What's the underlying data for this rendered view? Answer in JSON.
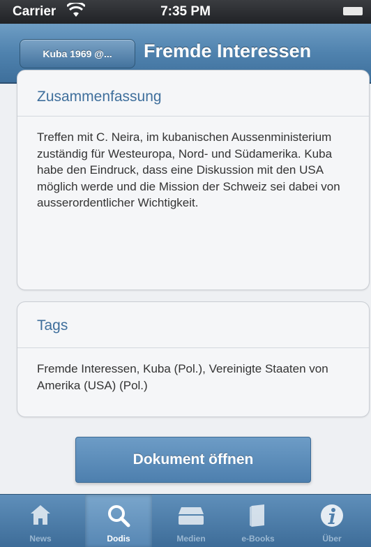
{
  "status_bar": {
    "carrier": "Carrier",
    "time": "7:35 PM"
  },
  "nav_bar": {
    "back_label": "Kuba 1969 @...",
    "title": "Fremde Interessen"
  },
  "summary": {
    "heading": "Zusammenfassung",
    "text": "Treffen mit C. Neira, im kubanischen Aussenministerium zuständig für Westeuropa, Nord- und Südamerika. Kuba habe den Eindruck, dass eine Diskussion mit den USA möglich werde und die Mission der Schweiz sei dabei von ausserordentlicher Wichtigkeit."
  },
  "tags": {
    "heading": "Tags",
    "text": "Fremde Interessen, Kuba (Pol.), Vereinigte Staaten von Amerika (USA) (Pol.)"
  },
  "open_button_label": "Dokument öffnen",
  "tab_bar": {
    "active_tab": "Dodis",
    "tabs": [
      {
        "label": "News",
        "icon": "home-icon"
      },
      {
        "label": "Dodis",
        "icon": "search-icon"
      },
      {
        "label": "Medien",
        "icon": "media-box-icon"
      },
      {
        "label": "e-Books",
        "icon": "book-icon"
      },
      {
        "label": "Über",
        "icon": "info-icon"
      }
    ]
  },
  "colors": {
    "accent": "#4f82ae",
    "heading_text": "#3f6f9c",
    "body_text": "#333333"
  }
}
